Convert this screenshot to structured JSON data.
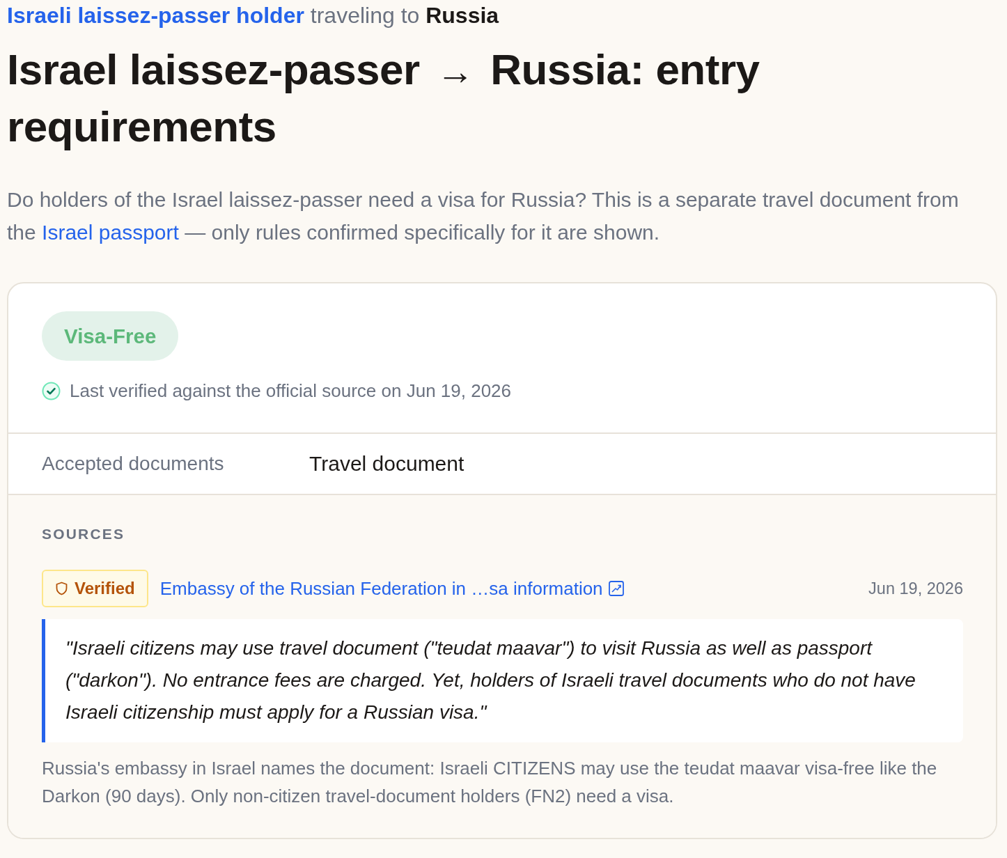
{
  "breadcrumb": {
    "document": "Israeli laissez-passer holder",
    "connector": "traveling to",
    "destination": "Russia"
  },
  "title": {
    "origin": "Israel laissez-passer",
    "arrow": "→",
    "destination": "Russia: entry requirements"
  },
  "intro": {
    "before": "Do holders of the Israel laissez-passer need a visa for Russia? This is a separate travel document from the",
    "link": "Israel passport",
    "after": "— only rules confirmed specifically for it are shown."
  },
  "status": {
    "badge": "Visa-Free",
    "kind": "visa_free",
    "verified": true,
    "verified_text": "Last verified against the official source on Jun 19, 2026"
  },
  "documents": {
    "label": "Accepted documents",
    "value": "Travel document"
  },
  "sources": {
    "heading": "SOURCES",
    "items": [
      {
        "badge": "Verified",
        "link": "Embassy of the Russian Federation in …sa information",
        "date": "Jun 19, 2026",
        "quote": "\"Israeli citizens may use travel document (\"teudat maavar\") to visit Russia as well as passport (\"darkon\"). No entrance fees are charged. Yet, holders of Israeli travel documents who do not have Israeli citizenship must apply for a Russian visa.\"",
        "note": "Russia's embassy in Israel names the document: Israeli CITIZENS may use the teudat maavar visa-free like the Darkon (90 days). Only non-citizen travel-document holders (FN2) need a visa."
      }
    ]
  }
}
